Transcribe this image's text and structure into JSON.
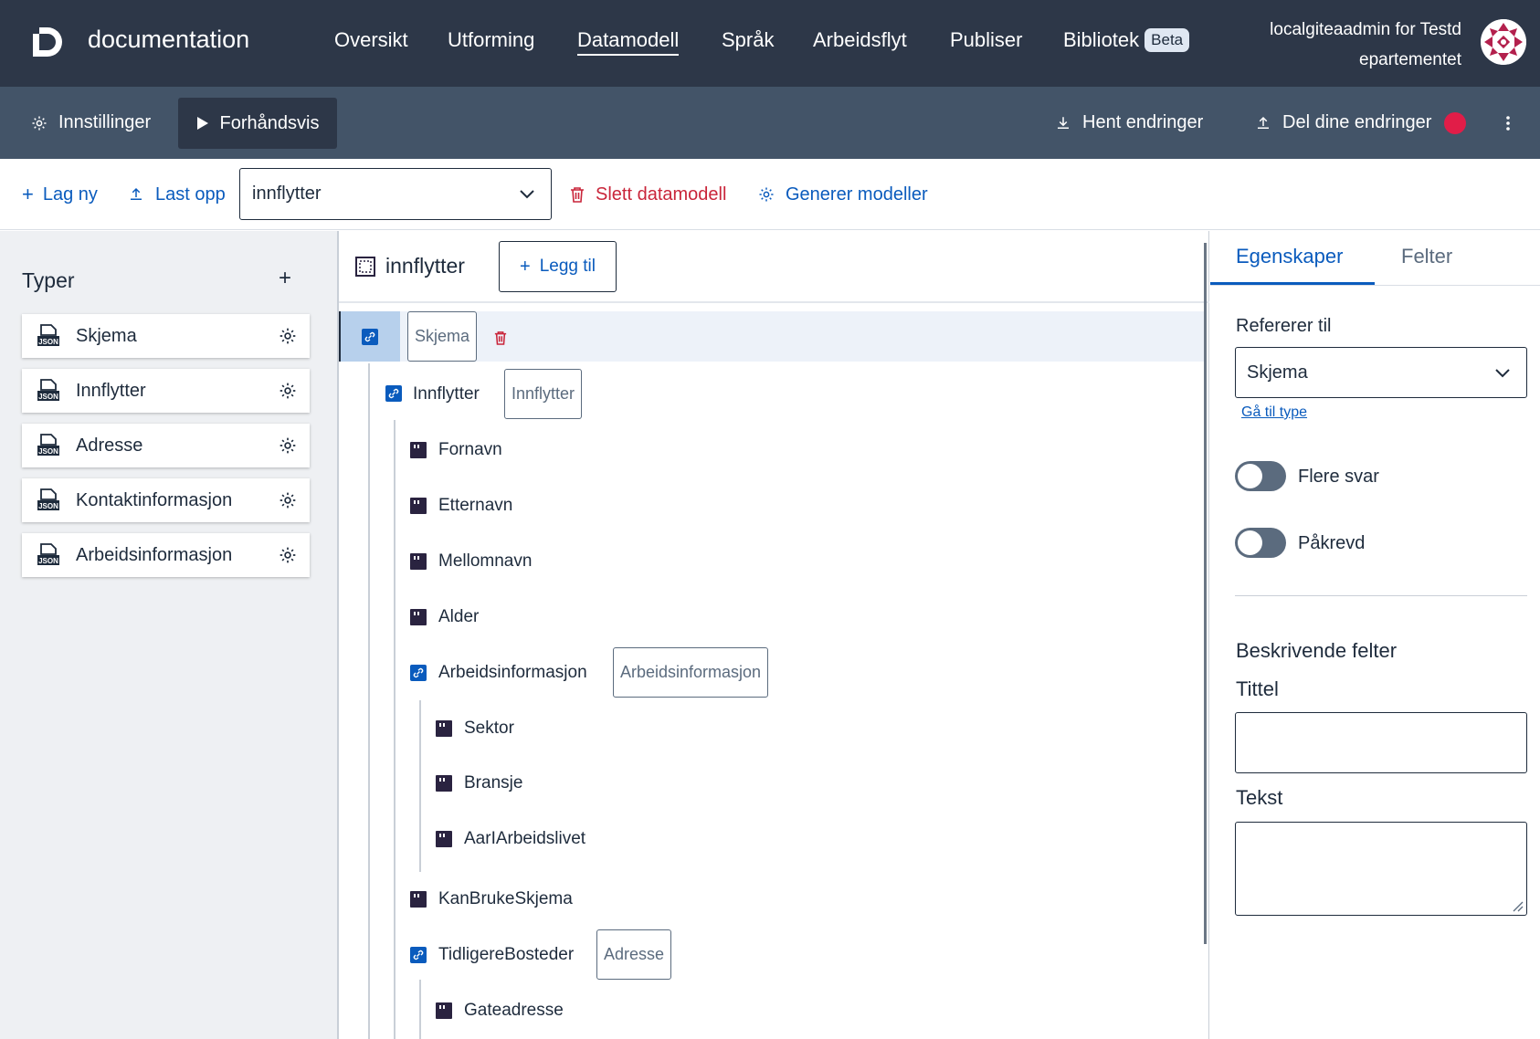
{
  "header": {
    "app_name": "documentation",
    "nav": [
      {
        "label": "Oversikt"
      },
      {
        "label": "Utforming"
      },
      {
        "label": "Datamodell",
        "active": true
      },
      {
        "label": "Språk"
      },
      {
        "label": "Arbeidsflyt"
      },
      {
        "label": "Publiser"
      },
      {
        "label": "Bibliotek",
        "badge": "Beta"
      }
    ],
    "user_line1": "localgiteaadmin for Testd",
    "user_line2": "epartementet"
  },
  "subheader": {
    "settings_label": "Innstillinger",
    "preview_label": "Forhåndsvis",
    "fetch_label": "Hent endringer",
    "share_label": "Del dine endringer",
    "share_indicator_color": "#e11d48"
  },
  "toolbar": {
    "new_label": "Lag ny",
    "upload_label": "Last opp",
    "model_selected": "innflytter",
    "delete_label": "Slett datamodell",
    "generate_label": "Generer modeller"
  },
  "types_panel": {
    "title": "Typer",
    "add_symbol": "+",
    "items": [
      {
        "label": "Skjema"
      },
      {
        "label": "Innflytter"
      },
      {
        "label": "Adresse"
      },
      {
        "label": "Kontaktinformasjon"
      },
      {
        "label": "Arbeidsinformasjon"
      }
    ]
  },
  "schema_tree": {
    "root_title": "innflytter",
    "add_label": "Legg til",
    "selected_tag": "Skjema",
    "nodes": [
      {
        "label": "Innflytter",
        "kind": "reference",
        "tag": "Innflytter"
      },
      {
        "label": "Fornavn",
        "kind": "field"
      },
      {
        "label": "Etternavn",
        "kind": "field"
      },
      {
        "label": "Mellomnavn",
        "kind": "field"
      },
      {
        "label": "Alder",
        "kind": "field"
      },
      {
        "label": "Arbeidsinformasjon",
        "kind": "reference",
        "tag": "Arbeidsinformasjon"
      },
      {
        "label": "Sektor",
        "kind": "field"
      },
      {
        "label": "Bransje",
        "kind": "field"
      },
      {
        "label": "AarIArbeidslivet",
        "kind": "field"
      },
      {
        "label": "KanBrukeSkjema",
        "kind": "field"
      },
      {
        "label": "TidligereBosteder",
        "kind": "reference",
        "tag": "Adresse"
      },
      {
        "label": "Gateadresse",
        "kind": "field"
      }
    ]
  },
  "properties_panel": {
    "tabs": [
      {
        "label": "Egenskaper",
        "active": true
      },
      {
        "label": "Felter"
      }
    ],
    "refers_to_label": "Refererer til",
    "refers_to_value": "Skjema",
    "goto_type_label": "Gå til type",
    "multiple_answers_label": "Flere svar",
    "multiple_answers_on": false,
    "required_label": "Påkrevd",
    "required_on": false,
    "descriptive_fields_title": "Beskrivende felter",
    "title_label": "Tittel",
    "title_value": "",
    "text_label": "Tekst",
    "text_value": ""
  },
  "colors": {
    "header_bg": "#2d3748",
    "subheader_bg": "#435468",
    "accent": "#0a5bbd",
    "danger": "#c9253a",
    "node_icon": "#2a2340",
    "ref_icon": "#0a5bbd"
  }
}
